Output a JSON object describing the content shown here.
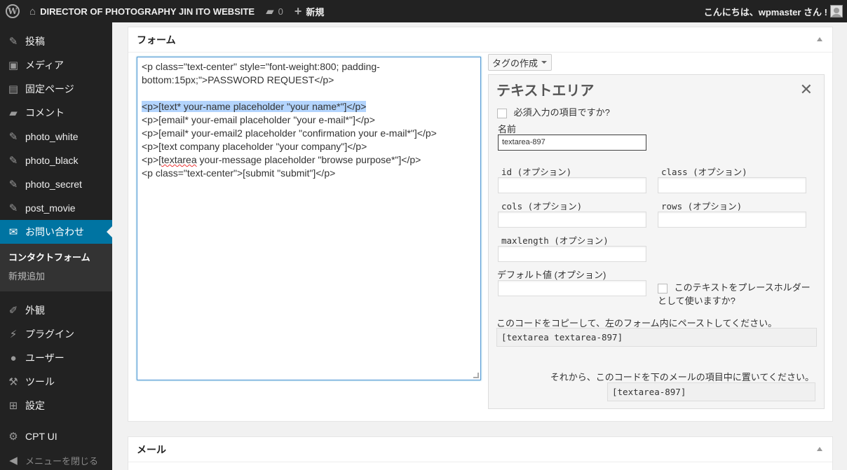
{
  "adminbar": {
    "site_name": "DIRECTOR OF PHOTOGRAPHY JIN ITO WEBSITE",
    "comments_count": "0",
    "new_label": "新規",
    "greeting": "こんにちは、wpmaster さん !"
  },
  "sidebar": {
    "items": [
      {
        "label": "投稿"
      },
      {
        "label": "メディア"
      },
      {
        "label": "固定ページ"
      },
      {
        "label": "コメント"
      },
      {
        "label": "photo_white"
      },
      {
        "label": "photo_black"
      },
      {
        "label": "photo_secret"
      },
      {
        "label": "post_movie"
      },
      {
        "label": "お問い合わせ"
      }
    ],
    "submenu": [
      {
        "label": "コンタクトフォーム"
      },
      {
        "label": "新規追加"
      }
    ],
    "items2": [
      {
        "label": "外観"
      },
      {
        "label": "プラグイン"
      },
      {
        "label": "ユーザー"
      },
      {
        "label": "ツール"
      },
      {
        "label": "設定"
      }
    ],
    "cpt_label": "CPT UI",
    "collapse_label": "メニューを閉じる"
  },
  "form_box": {
    "title": "フォーム",
    "code_lines": [
      "<p class=\"text-center\" style=\"font-weight:800; padding-",
      "bottom:15px;\">PASSWORD REQUEST</p>",
      "<p>[text* your-name placeholder \"your name*\"]</p>",
      "<p>[email* your-email placeholder \"your e-mail*\"]</p>",
      "<p>[email* your-email2 placeholder \"confirmation your e-mail*\"]</p>",
      "<p>[text company placeholder \"your company\"]</p>",
      "<p>[",
      "textarea",
      " your-message placeholder \"browse purpose*\"]</p>",
      "<p class=\"text-center\">[submit \"submit\"]</p>"
    ]
  },
  "tag_generator": {
    "button_label": "タグの作成",
    "panel_title": "テキストエリア",
    "required_label": "必須入力の項目ですか?",
    "name_label": "名前",
    "name_value": "textarea-897",
    "id_label": "id (オプション)",
    "class_label": "class (オプション)",
    "cols_label": "cols (オプション)",
    "rows_label": "rows (オプション)",
    "maxlength_label": "maxlength (オプション)",
    "default_label": "デフォルト値 (オプション)",
    "placeholder_line1": "このテキストをプレースホルダー",
    "placeholder_line2": "として使いますか?",
    "copy_instruction": "このコードをコピーして、左のフォーム内にペーストしてください。",
    "tag_code": "[textarea textarea-897]",
    "mail_instruction": "それから、このコードを下のメールの項目中に置いてください。",
    "mail_code": "[textarea-897]"
  },
  "mail_box": {
    "title": "メール"
  }
}
